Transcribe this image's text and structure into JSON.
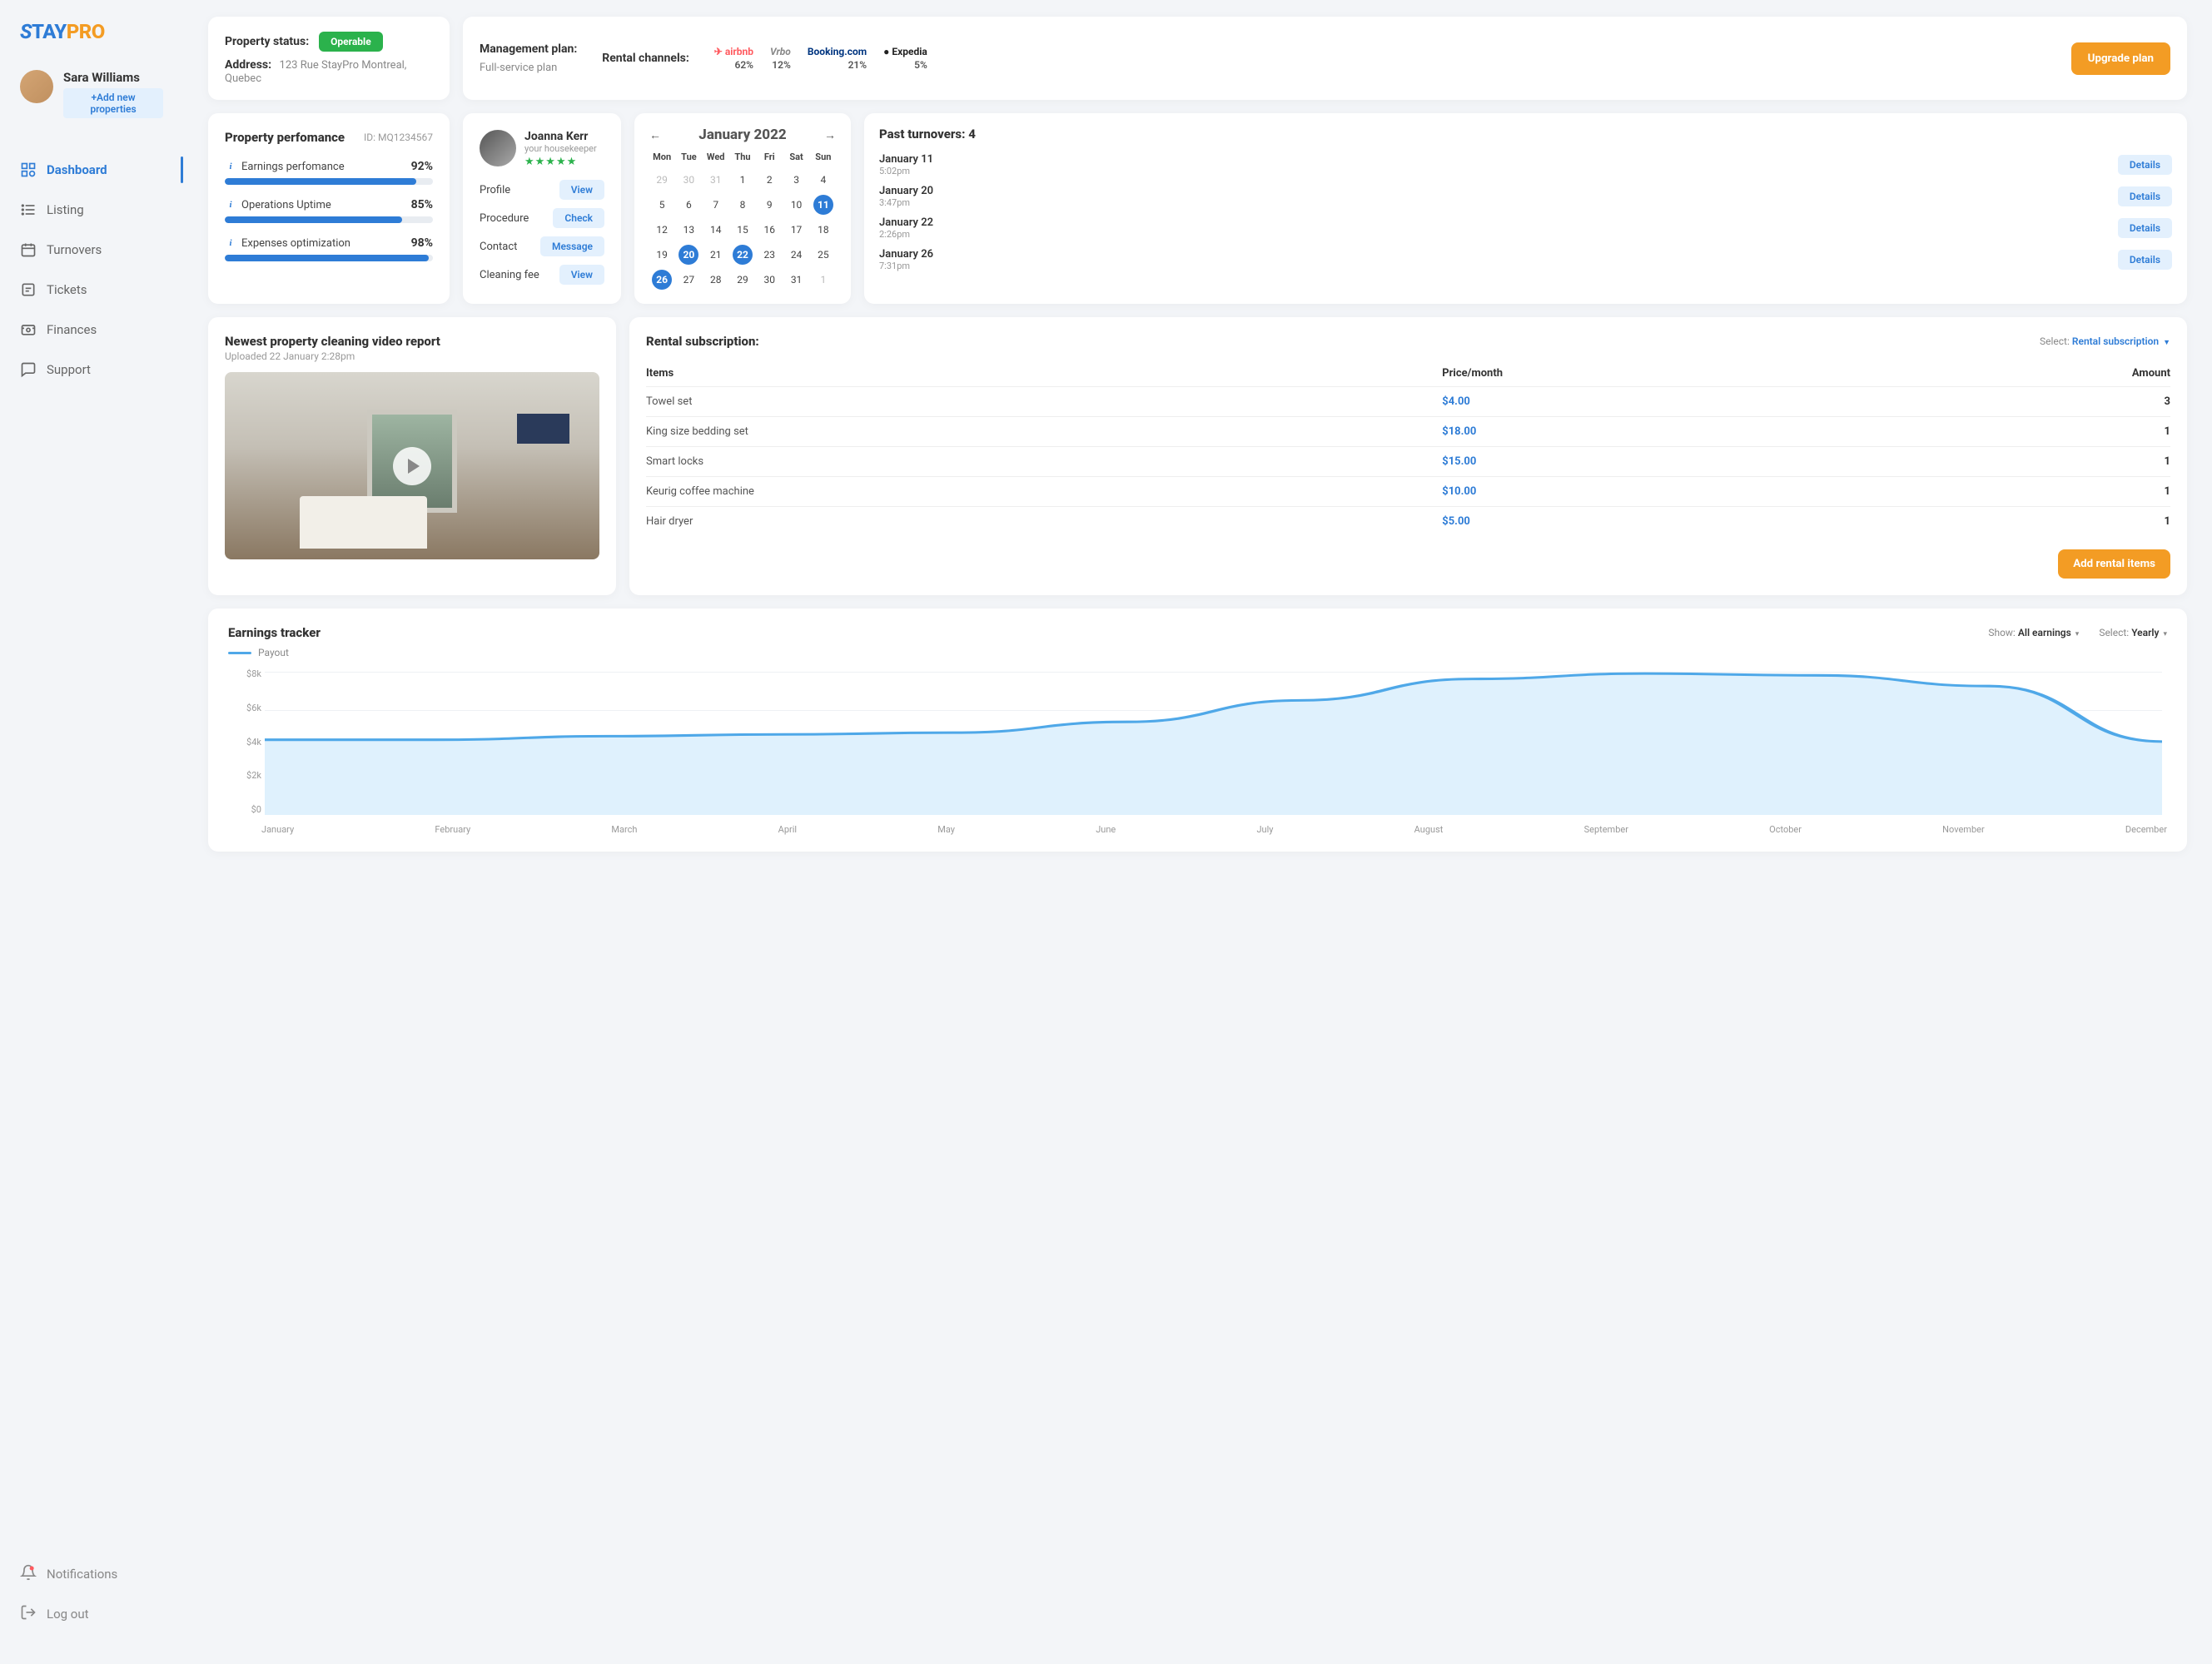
{
  "brand": {
    "s": "S",
    "tay": "TAY",
    "pro": "PRO"
  },
  "profile": {
    "name": "Sara Williams",
    "addBtn": "+Add new properties"
  },
  "nav": {
    "items": [
      {
        "label": "Dashboard"
      },
      {
        "label": "Listing"
      },
      {
        "label": "Turnovers"
      },
      {
        "label": "Tickets"
      },
      {
        "label": "Finances"
      },
      {
        "label": "Support"
      }
    ],
    "bottom": [
      {
        "label": "Notifications"
      },
      {
        "label": "Log out"
      }
    ]
  },
  "status": {
    "statusLabel": "Property status:",
    "statusBadge": "Operable",
    "addressLabel": "Address:",
    "addressValue": "123 Rue StayPro Montreal, Quebec"
  },
  "mgmt": {
    "planLabel": "Management plan:",
    "planValue": "Full-service plan",
    "channelsLabel": "Rental channels:",
    "channels": [
      {
        "brand": "airbnb",
        "pct": "62%"
      },
      {
        "brand": "Vrbo",
        "pct": "12%"
      },
      {
        "brand": "Booking.com",
        "pct": "21%"
      },
      {
        "brand": "Expedia",
        "pct": "5%"
      }
    ],
    "upgradeBtn": "Upgrade plan"
  },
  "perf": {
    "title": "Property perfomance",
    "idLabel": "ID:",
    "id": "MQ1234567",
    "metrics": [
      {
        "label": "Earnings perfomance",
        "value": "92%",
        "fill": 92
      },
      {
        "label": "Operations Uptime",
        "value": "85%",
        "fill": 85
      },
      {
        "label": "Expenses optimization",
        "value": "98%",
        "fill": 98
      }
    ]
  },
  "keeper": {
    "name": "Joanna Kerr",
    "role": "your housekeeper",
    "stars": "★★★★★",
    "rows": [
      {
        "label": "Profile",
        "btn": "View"
      },
      {
        "label": "Procedure",
        "btn": "Check"
      },
      {
        "label": "Contact",
        "btn": "Message"
      },
      {
        "label": "Cleaning fee",
        "btn": "View"
      }
    ]
  },
  "calendar": {
    "title": "January 2022",
    "dow": [
      "Mon",
      "Tue",
      "Wed",
      "Thu",
      "Fri",
      "Sat",
      "Sun"
    ],
    "weeks": [
      [
        {
          "d": "29",
          "m": true
        },
        {
          "d": "30",
          "m": true
        },
        {
          "d": "31",
          "m": true
        },
        {
          "d": "1"
        },
        {
          "d": "2"
        },
        {
          "d": "3"
        },
        {
          "d": "4"
        }
      ],
      [
        {
          "d": "5"
        },
        {
          "d": "6"
        },
        {
          "d": "7"
        },
        {
          "d": "8"
        },
        {
          "d": "9"
        },
        {
          "d": "10"
        },
        {
          "d": "11",
          "s": true
        }
      ],
      [
        {
          "d": "12"
        },
        {
          "d": "13"
        },
        {
          "d": "14"
        },
        {
          "d": "15"
        },
        {
          "d": "16"
        },
        {
          "d": "17"
        },
        {
          "d": "18"
        }
      ],
      [
        {
          "d": "19"
        },
        {
          "d": "20",
          "s": true
        },
        {
          "d": "21"
        },
        {
          "d": "22",
          "s": true
        },
        {
          "d": "23"
        },
        {
          "d": "24"
        },
        {
          "d": "25"
        }
      ],
      [
        {
          "d": "26",
          "s": true
        },
        {
          "d": "27"
        },
        {
          "d": "28"
        },
        {
          "d": "29"
        },
        {
          "d": "30"
        },
        {
          "d": "31"
        },
        {
          "d": "1",
          "m": true
        }
      ]
    ]
  },
  "turnovers": {
    "title": "Past turnovers: 4",
    "items": [
      {
        "date": "January 11",
        "time": "5:02pm",
        "btn": "Details"
      },
      {
        "date": "January 20",
        "time": "3:47pm",
        "btn": "Details"
      },
      {
        "date": "January 22",
        "time": "2:26pm",
        "btn": "Details"
      },
      {
        "date": "January 26",
        "time": "7:31pm",
        "btn": "Details"
      }
    ]
  },
  "video": {
    "title": "Newest property cleaning video report",
    "uploaded": "Uploaded 22 January 2:28pm"
  },
  "subscription": {
    "title": "Rental subscription:",
    "selectLabel": "Select:",
    "selectValue": "Rental subscription",
    "headers": [
      "Items",
      "Price/month",
      "Amount"
    ],
    "rows": [
      {
        "item": "Towel set",
        "price": "$4.00",
        "amount": "3"
      },
      {
        "item": "King size bedding set",
        "price": "$18.00",
        "amount": "1"
      },
      {
        "item": "Smart locks",
        "price": "$15.00",
        "amount": "1"
      },
      {
        "item": "Keurig coffee machine",
        "price": "$10.00",
        "amount": "1"
      },
      {
        "item": "Hair dryer",
        "price": "$5.00",
        "amount": "1"
      }
    ],
    "addBtn": "Add rental items"
  },
  "earnings": {
    "title": "Earnings tracker",
    "showLabel": "Show:",
    "showValue": "All earnings",
    "selectLabel": "Select:",
    "selectValue": "Yearly",
    "legend": "Payout"
  },
  "chart_data": {
    "type": "line",
    "title": "Earnings tracker",
    "xlabel": "",
    "ylabel": "",
    "ylim": [
      0,
      8000
    ],
    "categories": [
      "January",
      "February",
      "March",
      "April",
      "May",
      "June",
      "July",
      "August",
      "September",
      "October",
      "November",
      "December"
    ],
    "series": [
      {
        "name": "Payout",
        "values": [
          4200,
          4200,
          4400,
          4500,
          4600,
          5200,
          6400,
          7600,
          7900,
          7800,
          7200,
          4100
        ]
      }
    ],
    "yticks": [
      "$8k",
      "$6k",
      "$4k",
      "$2k",
      "$0"
    ]
  }
}
